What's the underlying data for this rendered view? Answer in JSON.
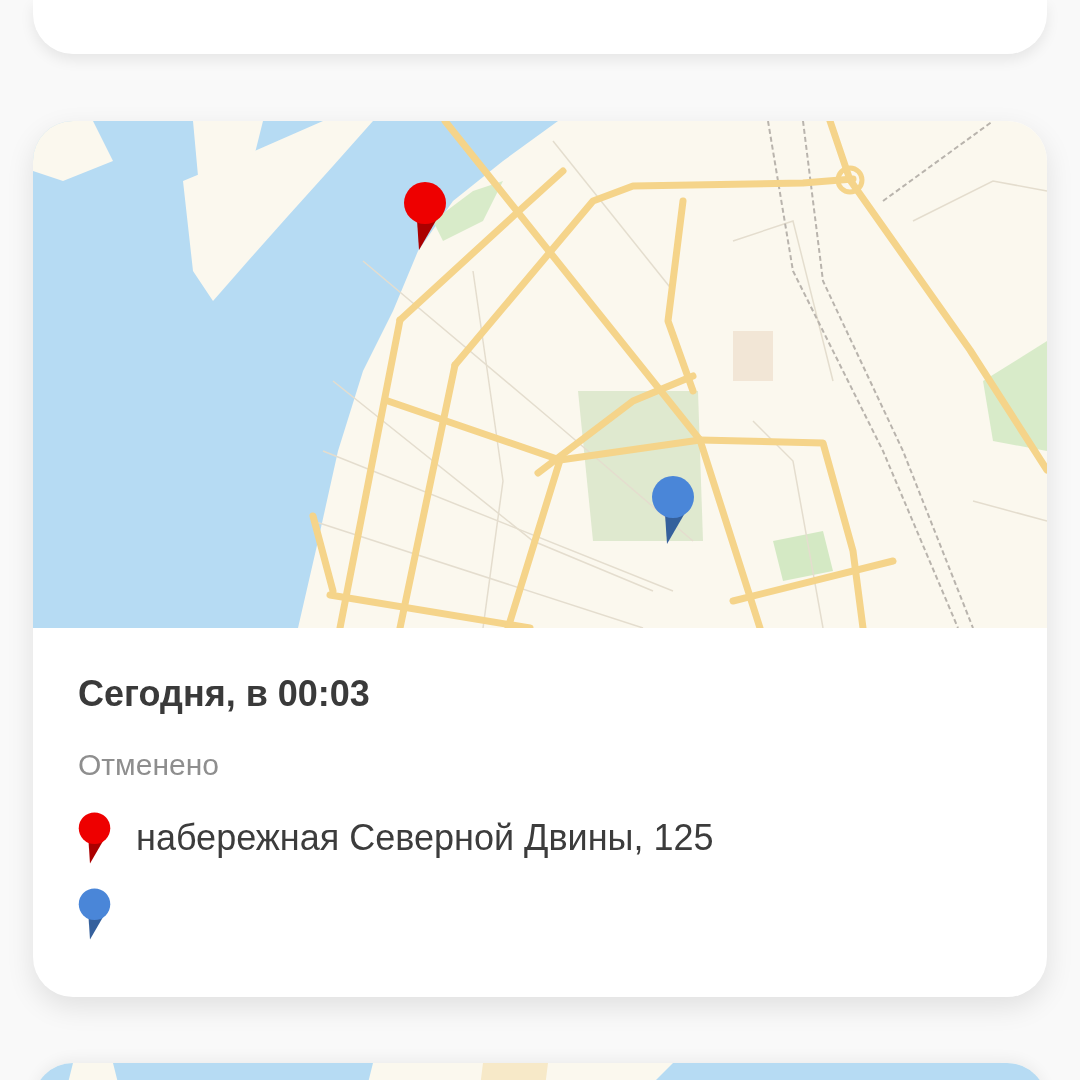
{
  "cards": [
    {
      "kind": "blank"
    },
    {
      "kind": "trip",
      "title": "Сегодня, в 00:03",
      "status": "Отменено",
      "stops": [
        {
          "color": "#ee0000",
          "address": "набережная Северной Двины, 125"
        },
        {
          "color": "#4a86d8"
        }
      ]
    },
    {
      "kind": "map"
    }
  ]
}
